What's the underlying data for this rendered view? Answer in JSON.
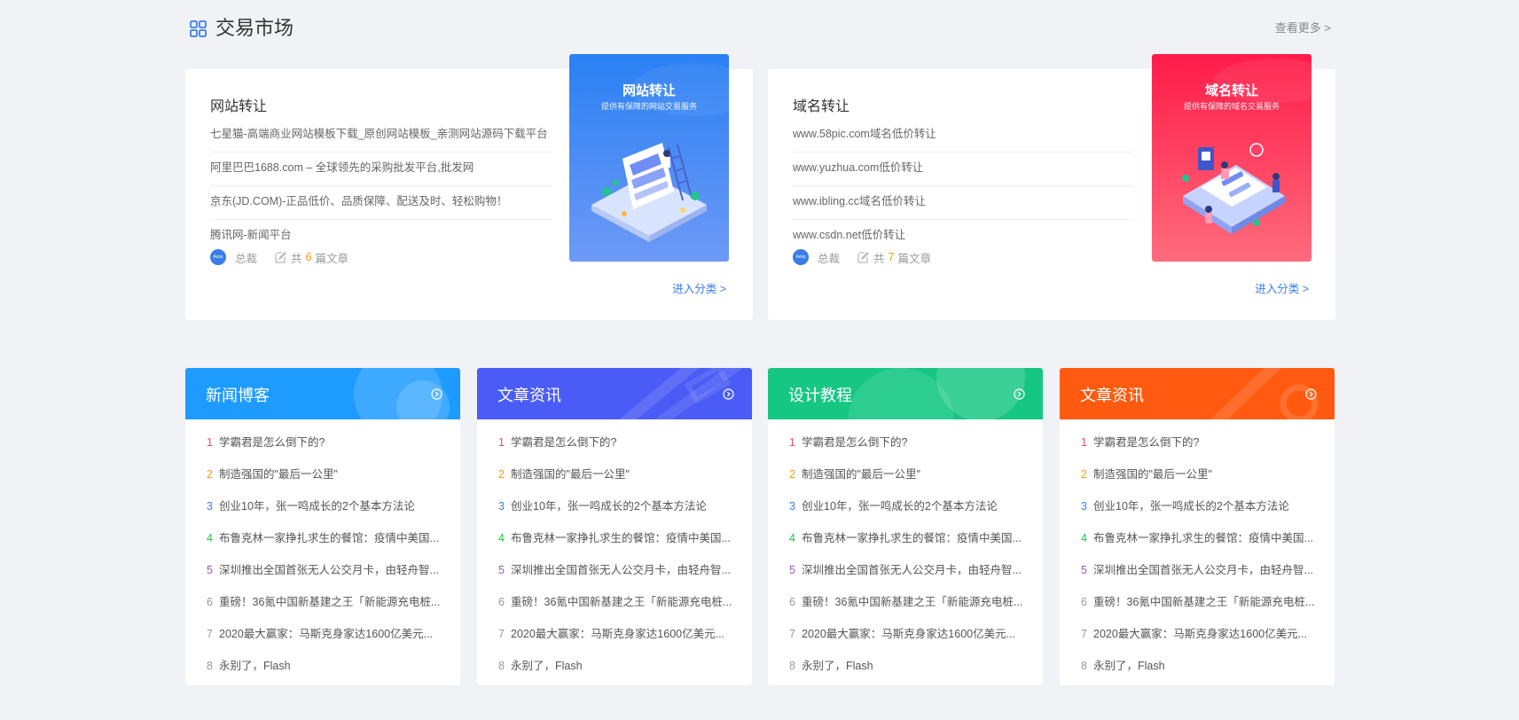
{
  "section": {
    "title": "交易市场",
    "more_label": "查看更多 >"
  },
  "market": [
    {
      "title": "网站转让",
      "items": [
        "七星猫-高端商业网站模板下载_原创网站模板_亲测网站源码下载平台",
        "阿里巴巴1688.com – 全球领先的采购批发平台,批发网",
        "京东(JD.COM)-正品低价、品质保障、配送及时、轻松购物！",
        "腾讯网-新闻平台"
      ],
      "avatar_text": "Aoss",
      "author": "总裁",
      "count_prefix": "共",
      "count": "6",
      "count_suffix": "篇文章",
      "enter_label": "进入分类 >",
      "banner": {
        "title": "网站转让",
        "subtitle": "提供有保障的网站交易服务",
        "color": "#2a80f4"
      }
    },
    {
      "title": "域名转让",
      "items": [
        "www.58pic.com域名低价转让",
        "www.yuzhua.com低价转让",
        "www.ibling.cc域名低价转让",
        "www.csdn.net低价转让"
      ],
      "avatar_text": "Aoss",
      "author": "总裁",
      "count_prefix": "共",
      "count": "7",
      "count_suffix": "篇文章",
      "enter_label": "进入分类 >",
      "banner": {
        "title": "域名转让",
        "subtitle": "提供有保障的域名交易服务",
        "color": "#ff1b49"
      }
    }
  ],
  "lists": [
    {
      "title": "新闻博客",
      "color": "#1e9bff"
    },
    {
      "title": "文章资讯",
      "color": "#4a5cf5"
    },
    {
      "title": "设计教程",
      "color": "#16c784"
    },
    {
      "title": "文章资讯",
      "color": "#ff5a0f"
    }
  ],
  "articles": [
    {
      "num": "1",
      "text": "学霸君是怎么倒下的?",
      "color": "#e84a5f"
    },
    {
      "num": "2",
      "text": "制造强国的\"最后一公里\"",
      "color": "#f39c12"
    },
    {
      "num": "3",
      "text": "创业10年，张一鸣成长的2个基本方法论",
      "color": "#3a7de8"
    },
    {
      "num": "4",
      "text": "布鲁克林一家挣扎求生的餐馆：疫情中美国...",
      "color": "#27c24c"
    },
    {
      "num": "5",
      "text": "深圳推出全国首张无人公交月卡，由轻舟智...",
      "color": "#9b59b6"
    },
    {
      "num": "6",
      "text": "重磅！36氪中国新基建之王「新能源充电桩...",
      "color": "#999999"
    },
    {
      "num": "7",
      "text": "2020最大赢家：马斯克身家达1600亿美元...",
      "color": "#999999"
    },
    {
      "num": "8",
      "text": "永别了，Flash",
      "color": "#999999"
    }
  ]
}
